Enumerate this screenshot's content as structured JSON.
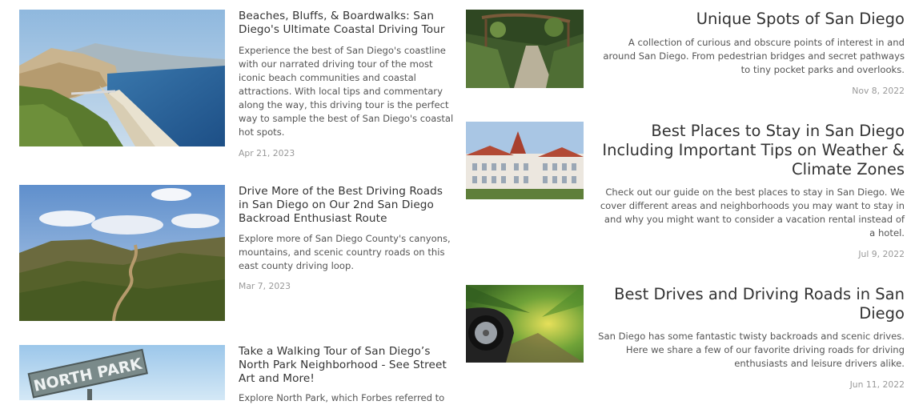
{
  "left_posts": [
    {
      "image_icon": "coastal-cliffs-photo",
      "title": "Beaches, Bluffs, & Boardwalks: San Diego's Ultimate Coastal Driving Tour",
      "excerpt": "Experience the best of San Diego's coastline with our narrated driving tour of the most iconic beach communities and coastal attractions. With local tips and commentary along the way, this driving tour is the perfect way to sample the best of San Diego's coastal hot spots.",
      "date": "Apr 21, 2023"
    },
    {
      "image_icon": "backroad-hills-photo",
      "title": "Drive More of the Best Driving Roads in San Diego on Our 2nd San Diego Backroad Enthusiast Route",
      "excerpt": "Explore more of San Diego County's canyons, mountains, and scenic country roads on this east county driving loop.",
      "date": "Mar 7, 2023"
    },
    {
      "image_icon": "north-park-sign-photo",
      "image_text": "NORTH PARK",
      "title": "Take a Walking Tour of San Diego’s North Park Neighborhood - See Street Art and More!",
      "excerpt": "Explore North Park, which Forbes referred to"
    }
  ],
  "right_posts": [
    {
      "image_icon": "garden-path-photo",
      "title": "Unique Spots of San Diego",
      "excerpt": "A collection of curious and obscure points of interest in and around San Diego. From pedestrian bridges and secret pathways to tiny pocket parks and overlooks.",
      "date": "Nov 8, 2022"
    },
    {
      "image_icon": "hotel-del-photo",
      "title": "Best Places to Stay in San Diego Including Important Tips on Weather & Climate Zones",
      "excerpt": "Check out our guide on the best places to stay in San Diego. We cover different areas and neighborhoods you may want to stay in and why you might want to consider a vacation rental instead of a hotel.",
      "date": "Jul 9, 2022"
    },
    {
      "image_icon": "speeding-car-photo",
      "title": "Best Drives and Driving Roads in San Diego",
      "excerpt": "San Diego has some fantastic twisty backroads and scenic drives. Here we share a few of our favorite driving roads for driving enthusiasts and leisure drivers alike.",
      "date": "Jun 11, 2022"
    }
  ]
}
